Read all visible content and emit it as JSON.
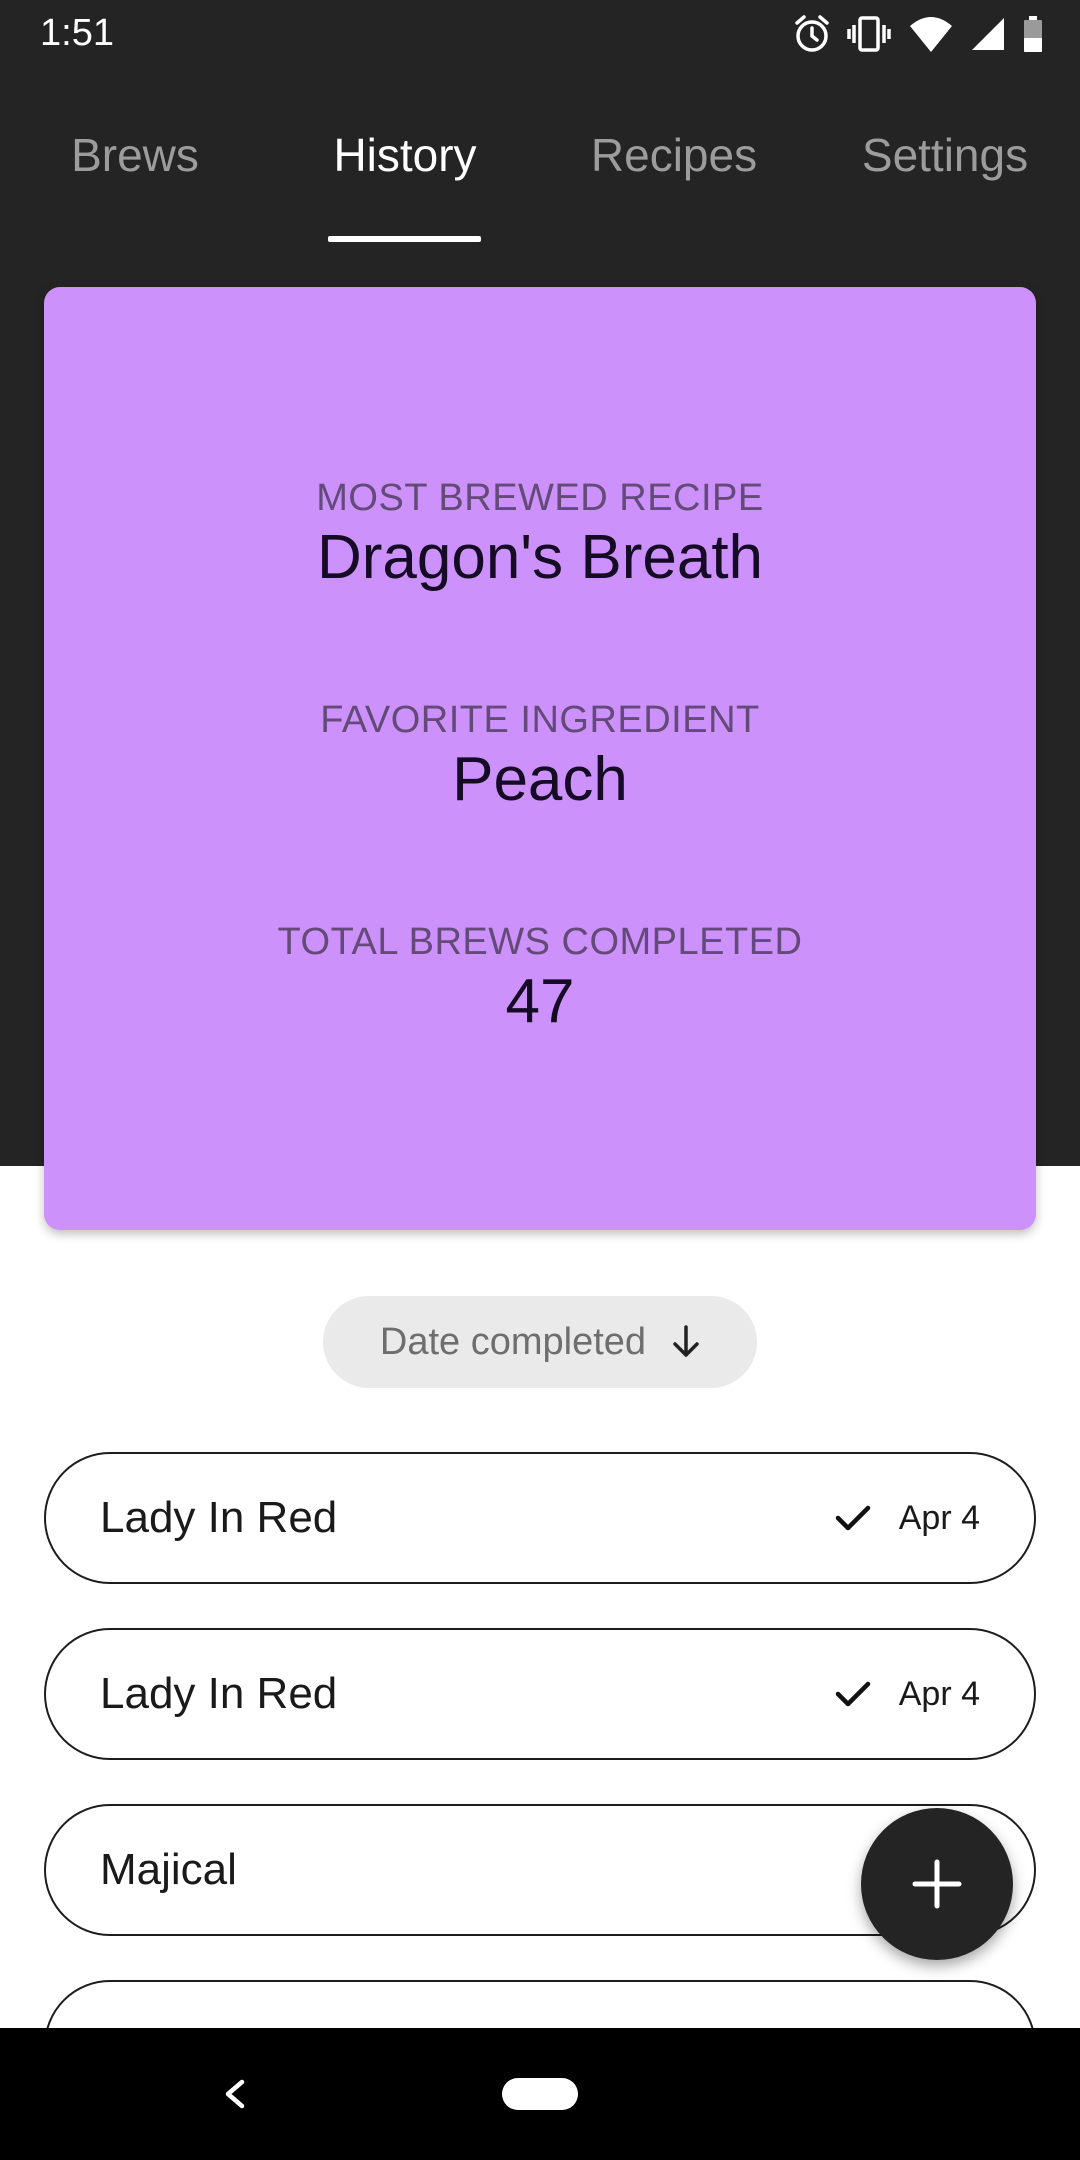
{
  "status_bar": {
    "time": "1:51",
    "icons": [
      "alarm-icon",
      "vibrate-icon",
      "wifi-icon",
      "signal-icon",
      "battery-icon"
    ]
  },
  "tabs": [
    {
      "label": "Brews",
      "active": false
    },
    {
      "label": "History",
      "active": true
    },
    {
      "label": "Recipes",
      "active": false
    },
    {
      "label": "Settings",
      "active": false
    }
  ],
  "stats": {
    "most_brewed_label": "MOST BREWED RECIPE",
    "most_brewed_value": "Dragon's Breath",
    "favorite_ingredient_label": "FAVORITE INGREDIENT",
    "favorite_ingredient_value": "Peach",
    "total_label": "TOTAL BREWS COMPLETED",
    "total_value": "47"
  },
  "sort": {
    "label": "Date completed",
    "direction_icon": "arrow-down-icon"
  },
  "brews": [
    {
      "name": "Lady In Red",
      "date": "Apr 4",
      "status_icon": "check-icon"
    },
    {
      "name": "Lady In Red",
      "date": "Apr 4",
      "status_icon": "check-icon"
    },
    {
      "name": "Majical",
      "date": "",
      "status_icon": "check-icon"
    }
  ],
  "fab": {
    "icon": "plus-icon"
  },
  "colors": {
    "header_background": "#242424",
    "card_accent": "#cc91fb",
    "chip_background": "#eaeaea"
  }
}
